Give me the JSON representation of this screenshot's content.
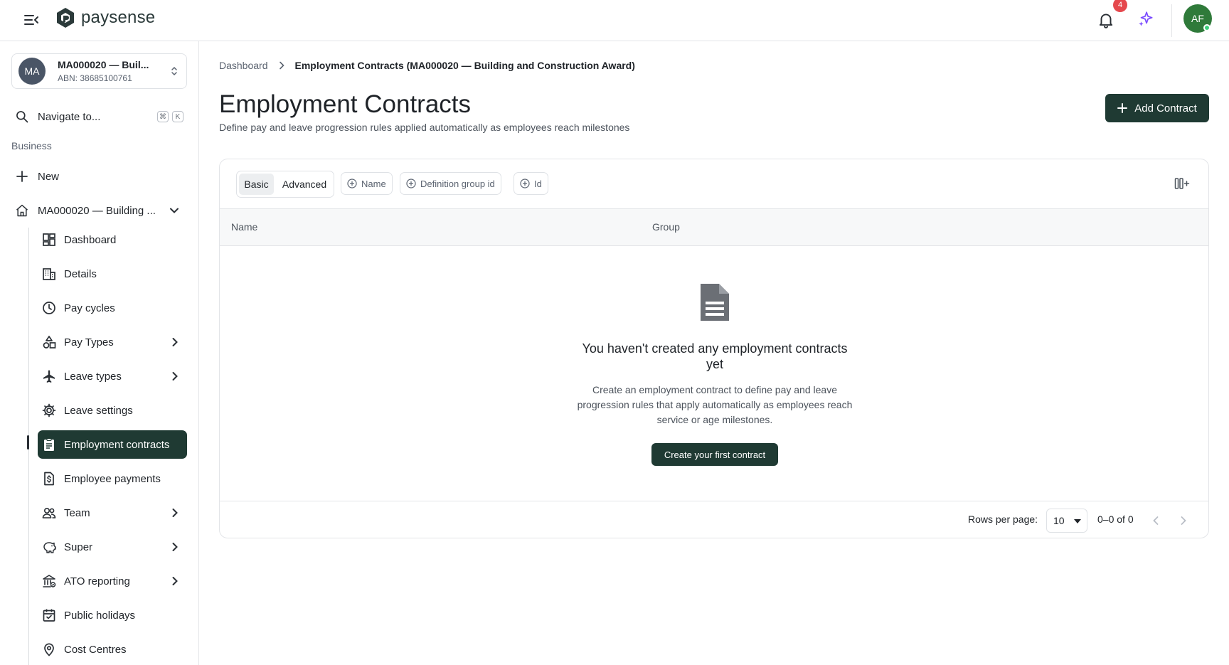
{
  "header": {
    "brand": "paysense",
    "notification_count": "4",
    "user_initials": "AF"
  },
  "sidebar": {
    "org": {
      "initials": "MA",
      "name": "MA000020 — Buil...",
      "abn": "ABN: 38685100761"
    },
    "search": {
      "label": "Navigate to...",
      "shortcut_mod": "⌘",
      "shortcut_key": "K"
    },
    "section_label": "Business",
    "new_label": "New",
    "org_tree_label": "MA000020 — Building ...",
    "items": [
      {
        "label": "Dashboard",
        "icon": "dashboard-icon"
      },
      {
        "label": "Details",
        "icon": "building-icon"
      },
      {
        "label": "Pay cycles",
        "icon": "clock-icon"
      },
      {
        "label": "Pay Types",
        "icon": "shapes-icon",
        "expandable": true
      },
      {
        "label": "Leave types",
        "icon": "plane-icon",
        "expandable": true
      },
      {
        "label": "Leave settings",
        "icon": "gear-icon"
      },
      {
        "label": "Employment contracts",
        "icon": "clipboard-icon",
        "active": true
      },
      {
        "label": "Employee payments",
        "icon": "dollar-file-icon"
      },
      {
        "label": "Team",
        "icon": "people-icon",
        "expandable": true
      },
      {
        "label": "Super",
        "icon": "piggy-bank-icon",
        "expandable": true
      },
      {
        "label": "ATO reporting",
        "icon": "bank-icon",
        "expandable": true
      },
      {
        "label": "Public holidays",
        "icon": "calendar-icon"
      },
      {
        "label": "Cost Centres",
        "icon": "location-pin-icon"
      }
    ]
  },
  "breadcrumb": {
    "root": "Dashboard",
    "current": "Employment Contracts (MA000020 — Building and Construction Award)"
  },
  "page": {
    "title": "Employment Contracts",
    "subtitle": "Define pay and leave progression rules applied automatically as employees reach milestones",
    "add_button": "Add Contract"
  },
  "filters": {
    "mode_basic": "Basic",
    "mode_advanced": "Advanced",
    "chips": [
      "Name",
      "Definition group id",
      "Id"
    ]
  },
  "table": {
    "columns": [
      "Name",
      "Group"
    ]
  },
  "empty_state": {
    "title": "You haven't created any employment contracts yet",
    "description": "Create an employment contract to define pay and leave progression rules that apply automatically as employees reach service or age milestones.",
    "button": "Create your first contract"
  },
  "pagination": {
    "rows_label": "Rows per page:",
    "rows_value": "10",
    "range": "0–0 of 0"
  },
  "colors": {
    "primary": "#1f3a33",
    "badge": "#e5484d",
    "avatar": "#2f7a3a",
    "sparkle": "#7c4dff"
  }
}
